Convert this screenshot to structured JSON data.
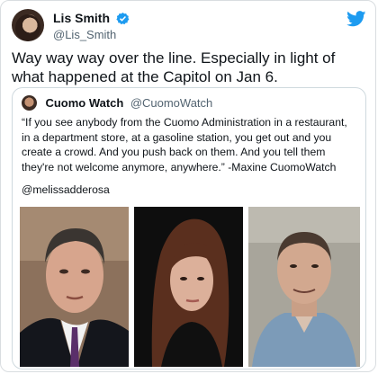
{
  "tweet": {
    "author": {
      "display_name": "Lis Smith",
      "handle": "@Lis_Smith",
      "verified": true,
      "avatar_icon": "profile-photo"
    },
    "platform_icon": "twitter-bird-icon",
    "text": "Way way way over the line. Especially in light of what happened at the Capitol on Jan 6.",
    "colors": {
      "brand": "#1d9bf0",
      "handle": "#536471"
    }
  },
  "quoted_tweet": {
    "author": {
      "display_name": "Cuomo Watch",
      "handle": "@CuomoWatch",
      "avatar_icon": "profile-photo"
    },
    "text": "“If you see anybody from the Cuomo Administration in a restaurant, in a department store, at a gasoline station, you get out and you create a crowd. And you push back on them. And you tell them they're not welcome anymore, anywhere.” -Maxine CuomoWatch",
    "mention": "@melissadderosa",
    "photos": [
      "man-in-suit-photo",
      "woman-dark-hair-photo",
      "man-blue-shirt-photo"
    ]
  }
}
